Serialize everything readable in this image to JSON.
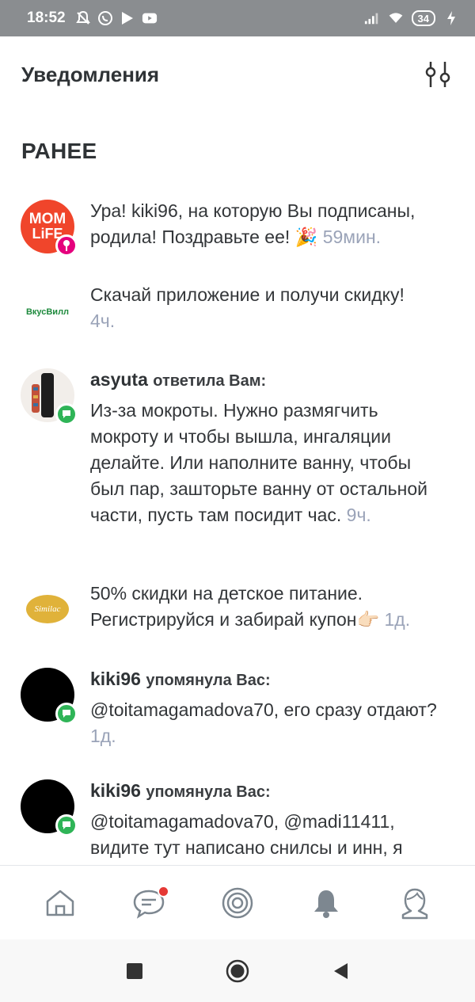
{
  "status_bar": {
    "time": "18:52",
    "battery": "34",
    "left_icons": [
      "do-not-disturb-icon",
      "whatsapp-icon",
      "play-icon",
      "youtube-icon"
    ],
    "right_icons": [
      "signal-icon",
      "wifi-icon",
      "battery-icon",
      "charging-icon"
    ]
  },
  "header": {
    "title": "Уведомления",
    "filter_icon": "filter-sliders-icon"
  },
  "section_title": "РАНЕЕ",
  "notifications": [
    {
      "avatar": "momlife-logo",
      "avatar_text_1": "MOM",
      "avatar_text_2": "LiFE",
      "text": "Ура! kiki96, на которую Вы подписаны, родила! Поздравьте ее! 🎉",
      "time": "59мин."
    },
    {
      "avatar": "vkusvill-logo",
      "avatar_text": "ВкусВилл",
      "text": "Скачай приложение и получи скидку!",
      "time": "4ч."
    },
    {
      "avatar": "asyuta-photo",
      "user": "asyuta",
      "action": "ответила Вам:",
      "text": "Из-за мокроты. Нужно размягчить мокроту и чтобы вышла, ингаляции делайте. Или наполните ванну, чтобы был пар, зашторьте ванну от остальной части, пусть там посидит час.",
      "time": "9ч."
    },
    {
      "avatar": "similac-logo",
      "avatar_text": "Similac",
      "text": "50% скидки на детское питание. Регистрируйся и забирай купон👉🏻",
      "time": "1д."
    },
    {
      "avatar": "kiki96-avatar",
      "user": "kiki96",
      "action": "упомянула Вас:",
      "text": "@toitamagamadova70, его сразу отдают?",
      "time": "1д."
    },
    {
      "avatar": "kiki96-avatar",
      "user": "kiki96",
      "action": "упомянула Вас:",
      "text": "@toitamagamadova70, @madi11411, видите тут написано снилсы и инн, я"
    }
  ],
  "bottom_nav": [
    "home-icon",
    "chat-icon",
    "target-icon",
    "bell-icon",
    "profile-icon"
  ],
  "system_nav": [
    "recent-apps-icon",
    "home-circle-icon",
    "back-icon"
  ],
  "colors": {
    "status_bar": "#8a8d90",
    "time_text": "#9aa3b8",
    "badge_chat": "#2fb457",
    "badge_pin": "#e5007d",
    "momlife_bg": "#f0452b",
    "notification_dot": "#e53935",
    "icon_gray": "#7d8790"
  }
}
